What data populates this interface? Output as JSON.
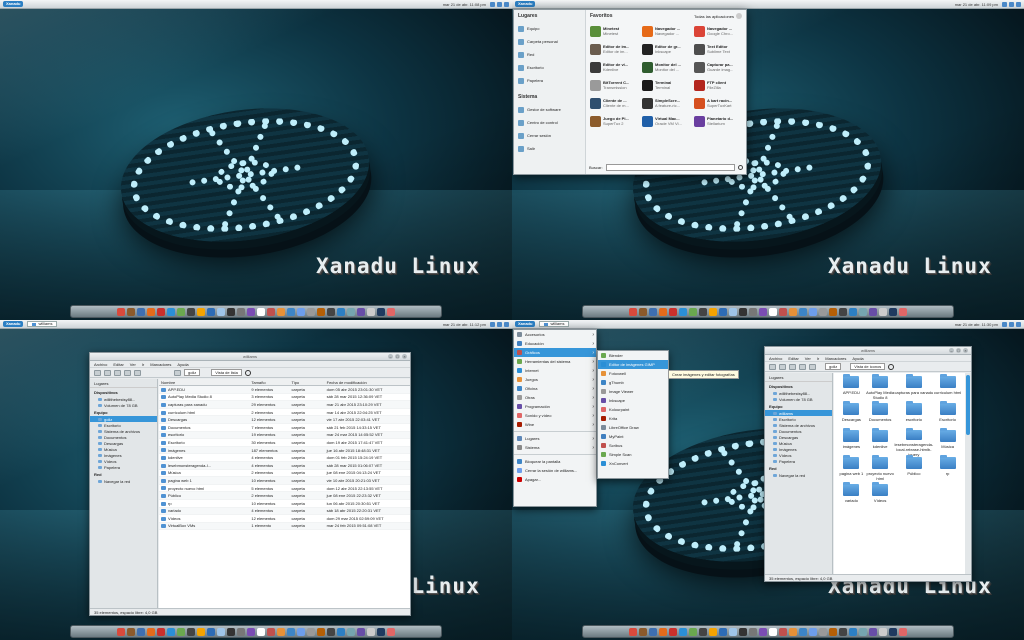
{
  "brand_text": "Xanadu Linux",
  "topbar": {
    "launcher_label": "Xanadu",
    "clock_q1": "mar 21 de abr. 11:08 pm",
    "clock_q2": "mar 21 de abr. 11:09 pm",
    "clock_q3": "mar 21 de abr. 11:12 pm",
    "clock_q4": "mar 21 de abr. 11:30 pm",
    "task_label": "williams"
  },
  "dock_colors": [
    "#d84a3c",
    "#8b5a2b",
    "#3e6fb0",
    "#e36b1c",
    "#c9302c",
    "#2b8fd6",
    "#6aa84f",
    "#444",
    "#f4a300",
    "#2d6cb5",
    "#9fc5e8",
    "#333",
    "#777",
    "#7a4db3",
    "#ffffff",
    "#c0504d",
    "#e69138",
    "#3d85c6",
    "#6d9eeb",
    "#999999",
    "#b45f06",
    "#444444",
    "#2c7fc3",
    "#76a5af",
    "#674ea7",
    "#cccccc",
    "#1f3a5f",
    "#e06666"
  ],
  "kickoff": {
    "places_header": "Lugares",
    "places": [
      "Equipo",
      "Carpeta personal",
      "Red",
      "Escritorio",
      "Papelera"
    ],
    "system_header": "Sistema",
    "system": [
      "Gestor de software",
      "Centro de control",
      "Cerrar sesión",
      "Salir"
    ],
    "fav_header": "Favoritos",
    "all_apps": "Todas las aplicaciones",
    "favorites": [
      {
        "name": "Minetest",
        "desc": "Minetest",
        "color": "#5a8f3a"
      },
      {
        "name": "Navegador ...",
        "desc": "Navegador ...",
        "color": "#e66a18"
      },
      {
        "name": "Navegador ...",
        "desc": "Google Chro...",
        "color": "#db4437"
      },
      {
        "name": "Editor de im...",
        "desc": "Editor de im...",
        "color": "#6b5d4f"
      },
      {
        "name": "Editor de gr...",
        "desc": "Inkscape",
        "color": "#222222"
      },
      {
        "name": "Text Editor",
        "desc": "Sublime Text",
        "color": "#4d4d4d"
      },
      {
        "name": "Editor de vi...",
        "desc": "Kdenlive",
        "color": "#3b3b3b"
      },
      {
        "name": "Monitor del ...",
        "desc": "Monitor del ...",
        "color": "#2e5c2e"
      },
      {
        "name": "Capturar pa...",
        "desc": "Guarde imag...",
        "color": "#555555"
      },
      {
        "name": "BitTorrent C...",
        "desc": "Transmission",
        "color": "#9a9a9a"
      },
      {
        "name": "Terminal",
        "desc": "Terminal",
        "color": "#1a1a1a"
      },
      {
        "name": "FTP client",
        "desc": "FileZilla",
        "color": "#b3261e"
      },
      {
        "name": "Cliente de ...",
        "desc": "Cliente de m...",
        "color": "#2f4f6f"
      },
      {
        "name": "SimpleScre...",
        "desc": "A feature-ric...",
        "color": "#333333"
      },
      {
        "name": "A kart racin...",
        "desc": "SuperTuxKart",
        "color": "#d64f1f"
      },
      {
        "name": "Juego de Pl...",
        "desc": "SuperTux 2",
        "color": "#8c5c2c"
      },
      {
        "name": "Virtual Mac...",
        "desc": "Oracle VM Vi...",
        "color": "#1f5fa8"
      },
      {
        "name": "Planetario d...",
        "desc": "Stellarium",
        "color": "#6a3fa0"
      }
    ],
    "search_label": "Buscar:",
    "search_value": ""
  },
  "filemanager": {
    "title": "williams",
    "menu": [
      "Archivo",
      "Editar",
      "Ver",
      "Ir",
      "Marcadores",
      "Ayuda"
    ],
    "path_label": "goliz",
    "view_mode": "Vista de lista",
    "side_places": "Lugares",
    "side_devices": "Dispositivos",
    "devices": [
      "willithebestsy88...",
      "Volumen de 78 GB"
    ],
    "side_equipo": "Equipo",
    "equipo": [
      "goliz",
      "Escritorio",
      "Sistema de archivos",
      "Documentos",
      "Descargas",
      "Música",
      "Imágenes",
      "Vídeos",
      "Papelera"
    ],
    "side_red": "Red",
    "red": [
      "Navegar la red"
    ],
    "columns": [
      "Nombre",
      "Tamaño",
      "Tipo",
      "Fecha de modificación"
    ],
    "rows": [
      [
        "APP.EDU",
        "9 elementos",
        "carpeta",
        "dom 05 abr 2015 23:01:30 VET"
      ],
      [
        "AutoPlay Media Studio 8",
        "3 elementos",
        "carpeta",
        "sáb 28 mar 2015 12:36:09 VET"
      ],
      [
        "capturas para xanadu",
        "29 elementos",
        "carpeta",
        "mar 21 abr 2015 23:10:29 VET"
      ],
      [
        "curriculum html",
        "2 elementos",
        "carpeta",
        "mar 14 abr 2015 22:04:25 VET"
      ],
      [
        "Descargas",
        "12 elementos",
        "carpeta",
        "vie 17 abr 2015 22:03:41 VET"
      ],
      [
        "Documentos",
        "7 elementos",
        "carpeta",
        "sáb 21 feb 2015 14:33:15 VET"
      ],
      [
        "escritorio",
        "19 elementos",
        "carpeta",
        "mar 24 mar 2015 14:05:52 VET"
      ],
      [
        "Escritorio",
        "30 elementos",
        "carpeta",
        "dom 19 abr 2015 17:41:47 VET"
      ],
      [
        "imágenes",
        "187 elementos",
        "carpeta",
        "jue 16 abr 2015 18:48:31 VET"
      ],
      [
        "kdenlive",
        "4 elementos",
        "carpeta",
        "dom 01 feb 2015 15:24:19 VET"
      ],
      [
        "lesebmonsteragenda-l...",
        "4 elementos",
        "carpeta",
        "sáb 28 mar 2015 01:06:07 VET"
      ],
      [
        "Música",
        "2 elementos",
        "carpeta",
        "jue 08 ene 2015 04:13:24 VET"
      ],
      [
        "pagina web 1",
        "10 elementos",
        "carpeta",
        "vie 10 abr 2015 20:21:03 VET"
      ],
      [
        "proyecto nuevo html",
        "5 elementos",
        "carpeta",
        "dom 12 abr 2015 22:13:55 VET"
      ],
      [
        "Público",
        "2 elementos",
        "carpeta",
        "jue 08 ene 2015 22:23:32 VET"
      ],
      [
        "rp",
        "10 elementos",
        "carpeta",
        "lun 06 abr 2015 20:30:51 VET"
      ],
      [
        "variado",
        "4 elementos",
        "carpeta",
        "sáb 18 abr 2015 22:20:31 VET"
      ],
      [
        "Vídeos",
        "12 elementos",
        "carpeta",
        "dom 29 mar 2015 02:59:09 VET"
      ],
      [
        "VirtualBox VMs",
        "1 elemento",
        "carpeta",
        "mar 24 feb 2015 09:51:08 VET"
      ]
    ],
    "status": "35 elementos, espacio libre: 4,0 GB"
  },
  "appmenu": {
    "task_label": "williams",
    "categories": [
      "Accesorios",
      "Educación",
      "Gráficos",
      "Herramientas del sistema",
      "Internet",
      "Juegos",
      "Oficina",
      "Otras",
      "Programación",
      "Sonido y vídeo",
      "Wine"
    ],
    "selected_category": "Gráficos",
    "places": "Lugares",
    "system": "Sistema",
    "actions": [
      "Bloquear la pantalla",
      "Cerrar la sesión de williams...",
      "Apagar..."
    ],
    "submenu": [
      "Blender",
      "Editor de imágenes GIMP",
      "Fotoxwell",
      "gThumb",
      "Image Viewer",
      "Inkscape",
      "Kolourpaint",
      "Krita",
      "LibreOffice Draw",
      "MyPaint",
      "Scribus",
      "Simple Scan",
      "XnConvert"
    ],
    "selected_submenu": "Editor de imágenes GIMP",
    "tooltip": "Crear imágenes y editar fotografías"
  },
  "iconview": {
    "title": "williams",
    "menu": [
      "Archivo",
      "Editar",
      "Ver",
      "Ir",
      "Marcadores",
      "Ayuda"
    ],
    "path_label": "goliz",
    "view_mode": "Vista de iconos",
    "side_places": "Lugares",
    "side_devices": "Dispositivos",
    "devices": [
      "willithebestsy88...",
      "Volumen de 78 GB"
    ],
    "side_equipo": "Equipo",
    "equipo": [
      "williams",
      "Escritorio",
      "Sistema de archivos",
      "Documentos",
      "Descargas",
      "Música",
      "Imágenes",
      "Vídeos",
      "Papelera"
    ],
    "side_red": "Red",
    "red": [
      "Navegar la red"
    ],
    "items": [
      "APP.EDU",
      "AutoPlay Media Studio 8",
      "capturas para xanadu",
      "curriculum html",
      "Descargas",
      "Documentos",
      "escritorio",
      "Escritorio",
      "imágenes",
      "kdenlive",
      "lesebmonsteragenda-local-release-htmlb-jquery",
      "Música",
      "pagina web 1",
      "proyecto nuevo html",
      "Público",
      "rp",
      "variado",
      "Vídeos"
    ],
    "status": "35 elementos, espacio libre: 4,0 GB"
  }
}
